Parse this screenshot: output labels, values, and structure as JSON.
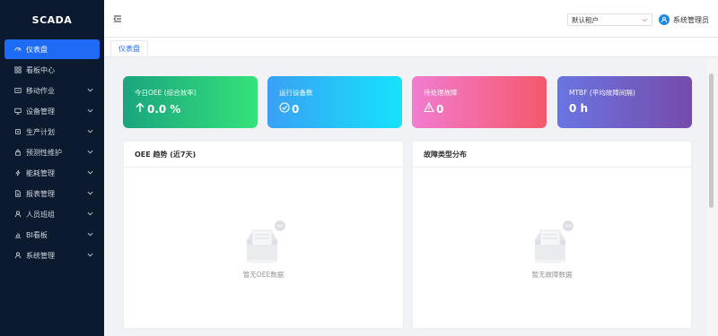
{
  "app": {
    "logo": "SCADA"
  },
  "sidebar": {
    "items": [
      {
        "label": "仪表盘",
        "icon": "dashboard-icon",
        "active": true,
        "expandable": false
      },
      {
        "label": "看板中心",
        "icon": "grid-icon",
        "active": false,
        "expandable": false
      },
      {
        "label": "移动作业",
        "icon": "mobile-icon",
        "active": false,
        "expandable": true
      },
      {
        "label": "设备管理",
        "icon": "monitor-icon",
        "active": false,
        "expandable": true
      },
      {
        "label": "生产计划",
        "icon": "cpu-icon",
        "active": false,
        "expandable": true
      },
      {
        "label": "预测性维护",
        "icon": "lock-icon",
        "active": false,
        "expandable": true
      },
      {
        "label": "能耗管理",
        "icon": "lightning-icon",
        "active": false,
        "expandable": true
      },
      {
        "label": "报表管理",
        "icon": "document-icon",
        "active": false,
        "expandable": true
      },
      {
        "label": "人员班组",
        "icon": "user-icon",
        "active": false,
        "expandable": true
      },
      {
        "label": "BI看板",
        "icon": "bar-chart-icon",
        "active": false,
        "expandable": true
      },
      {
        "label": "系统管理",
        "icon": "user-settings-icon",
        "active": false,
        "expandable": true
      }
    ]
  },
  "header": {
    "tenant_select_value": "默认租户",
    "user_name": "系统管理员"
  },
  "tabs": [
    {
      "label": "仪表盘",
      "active": true
    }
  ],
  "stats": {
    "oee": {
      "label": "今日OEE (综合效率)",
      "value": "0.0 %",
      "icon": "arrow-up-icon"
    },
    "running": {
      "label": "运行设备数",
      "value": "0",
      "icon": "check-circle-icon"
    },
    "faults": {
      "label": "待处理故障",
      "value": "0",
      "icon": "warning-icon"
    },
    "mtbf": {
      "label": "MTBF (平均故障间隔)",
      "value": "0 h"
    }
  },
  "panels": {
    "oee_trend": {
      "title": "OEE 趋势 (近7天)",
      "empty_text": "暂无OEE数据"
    },
    "fault_types": {
      "title": "故障类型分布",
      "empty_text": "暂无故障数据"
    }
  },
  "colors": {
    "sidebar_bg": "#0b1a2f",
    "accent": "#1e6bf5",
    "oee_gradient": [
      "#1aa57e",
      "#35e27a"
    ],
    "running_gradient": [
      "#3aa0f5",
      "#14e3fc"
    ],
    "faults_gradient": [
      "#f27cd0",
      "#f5586b"
    ],
    "mtbf_gradient": [
      "#6a75e2",
      "#764baa"
    ]
  }
}
